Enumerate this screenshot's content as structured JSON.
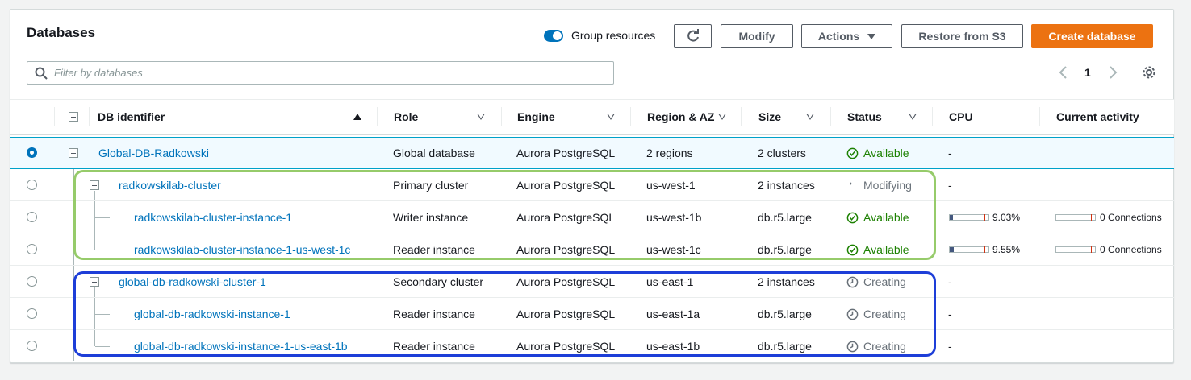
{
  "header": {
    "title": "Databases",
    "group_toggle_label": "Group resources",
    "modify_label": "Modify",
    "actions_label": "Actions",
    "restore_label": "Restore from S3",
    "create_label": "Create database"
  },
  "search": {
    "placeholder": "Filter by databases"
  },
  "pagination": {
    "page": "1"
  },
  "columns": {
    "db_identifier": "DB identifier",
    "role": "Role",
    "engine": "Engine",
    "region": "Region & AZ",
    "size": "Size",
    "status": "Status",
    "cpu": "CPU",
    "activity": "Current activity"
  },
  "rows": [
    {
      "id": "Global-DB-Radkowski",
      "role": "Global database",
      "engine": "Aurora PostgreSQL",
      "region": "2 regions",
      "size": "2 clusters",
      "status": "Available",
      "status_type": "available",
      "cpu": "-",
      "activity": "",
      "selected": true
    },
    {
      "id": "radkowskilab-cluster",
      "role": "Primary cluster",
      "engine": "Aurora PostgreSQL",
      "region": "us-west-1",
      "size": "2 instances",
      "status": "Modifying",
      "status_type": "modifying",
      "cpu": "-",
      "activity": ""
    },
    {
      "id": "radkowskilab-cluster-instance-1",
      "role": "Writer instance",
      "engine": "Aurora PostgreSQL",
      "region": "us-west-1b",
      "size": "db.r5.large",
      "status": "Available",
      "status_type": "available",
      "cpu": "9.03%",
      "cpu_value": 9.03,
      "activity": "0 Connections"
    },
    {
      "id": "radkowskilab-cluster-instance-1-us-west-1c",
      "role": "Reader instance",
      "engine": "Aurora PostgreSQL",
      "region": "us-west-1c",
      "size": "db.r5.large",
      "status": "Available",
      "status_type": "available",
      "cpu": "9.55%",
      "cpu_value": 9.55,
      "activity": "0 Connections"
    },
    {
      "id": "global-db-radkowski-cluster-1",
      "role": "Secondary cluster",
      "engine": "Aurora PostgreSQL",
      "region": "us-east-1",
      "size": "2 instances",
      "status": "Creating",
      "status_type": "creating",
      "cpu": "-",
      "activity": ""
    },
    {
      "id": "global-db-radkowski-instance-1",
      "role": "Reader instance",
      "engine": "Aurora PostgreSQL",
      "region": "us-east-1a",
      "size": "db.r5.large",
      "status": "Creating",
      "status_type": "creating",
      "cpu": "-",
      "activity": ""
    },
    {
      "id": "global-db-radkowski-instance-1-us-east-1b",
      "role": "Reader instance",
      "engine": "Aurora PostgreSQL",
      "region": "us-east-1b",
      "size": "db.r5.large",
      "status": "Creating",
      "status_type": "creating",
      "cpu": "-",
      "activity": ""
    }
  ],
  "icons": {
    "refresh": "refresh-icon",
    "settings": "gear-icon",
    "search": "search-icon",
    "prev": "chevron-left-icon",
    "next": "chevron-right-icon"
  },
  "colors": {
    "accent": "#0073bb",
    "primary_button": "#ec7211",
    "available": "#1d8102",
    "highlight_primary_region": "#96cb6a",
    "highlight_secondary_region": "#1d3ed8"
  }
}
